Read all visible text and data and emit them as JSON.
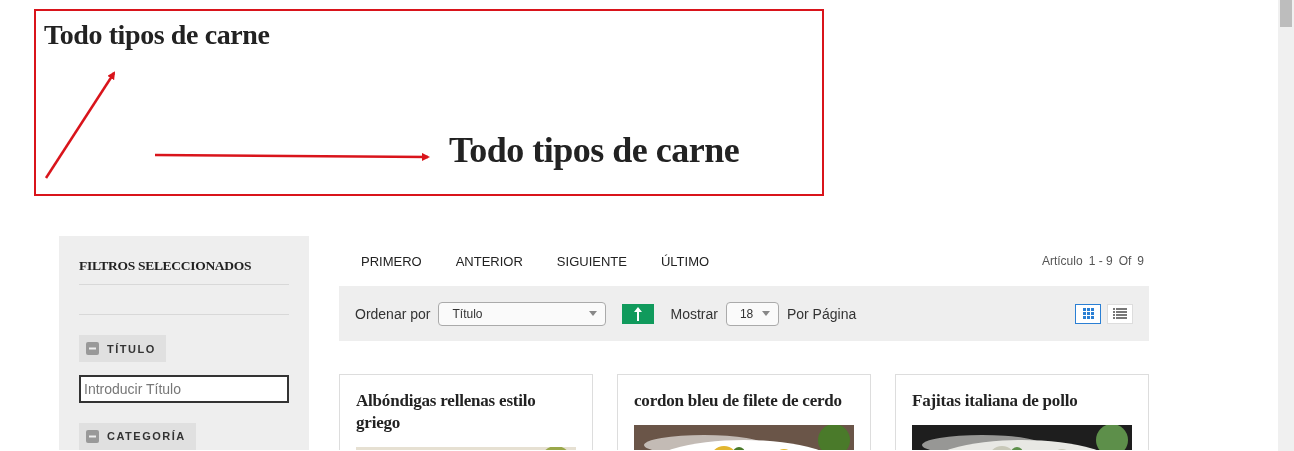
{
  "annotation": {
    "headings": [
      "Todo tipos de carne",
      "Todo tipos de carne"
    ]
  },
  "sidebar": {
    "title": "FILTROS SELECCIONADOS",
    "filters": [
      {
        "label": "TÍTULO",
        "expanded": true,
        "placeholder": "Introducir Título"
      },
      {
        "label": "CATEGORÍA",
        "expanded": true
      }
    ]
  },
  "pager": {
    "links": [
      "PRIMERO",
      "ANTERIOR",
      "SIGUIENTE",
      "ÚLTIMO"
    ],
    "summary": [
      "Artículo",
      "1 - 9",
      "Of",
      "9"
    ]
  },
  "toolbar": {
    "sort_label": "Ordenar por",
    "sort_value": "Título",
    "show_label": "Mostrar",
    "show_value": "18",
    "per_page_label": "Por Página",
    "views": [
      {
        "kind": "grid",
        "selected": true
      },
      {
        "kind": "list",
        "selected": false
      }
    ]
  },
  "cards": [
    {
      "title": "Albóndigas rellenas estilo griego"
    },
    {
      "title": "cordon bleu de filete de cerdo"
    },
    {
      "title": "Fajitas italiana de pollo"
    }
  ]
}
